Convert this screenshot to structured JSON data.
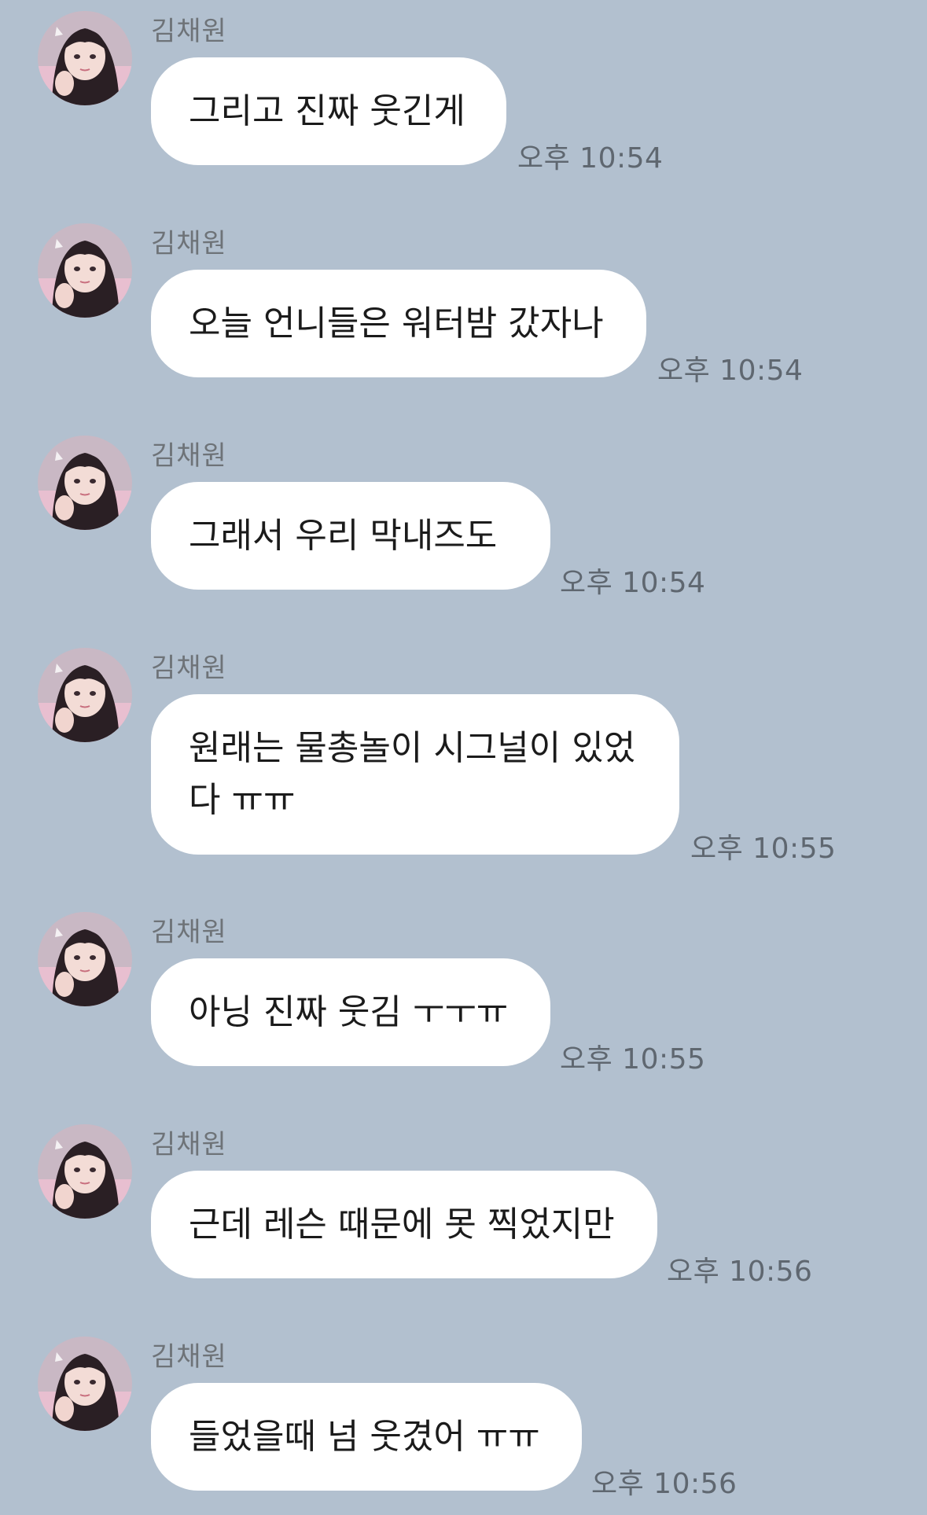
{
  "sender": "김채원",
  "messages": [
    {
      "text": "그리고 진짜 웃긴게",
      "time": "오후 10:54"
    },
    {
      "text": "오늘 언니들은 워터밤 갔자나",
      "time": "오후 10:54"
    },
    {
      "text": "그래서 우리 막내즈도",
      "time": "오후 10:54"
    },
    {
      "text": "원래는 물총놀이 시그널이 있었다 ㅠㅠ",
      "time": "오후 10:55"
    },
    {
      "text": "아닝 진짜 웃김 ㅜㅜㅠ",
      "time": "오후 10:55"
    },
    {
      "text": "근데 레슨 때문에 못 찍었지만",
      "time": "오후 10:56"
    },
    {
      "text": "들었을때 넘 웃겼어 ㅠㅠ",
      "time": "오후 10:56"
    }
  ],
  "colors": {
    "background": "#b2c0cf",
    "bubble": "#ffffff",
    "sender_text": "#6e7378",
    "time_text": "#5f6770"
  },
  "icons": {
    "avatar": "profile-photo"
  }
}
